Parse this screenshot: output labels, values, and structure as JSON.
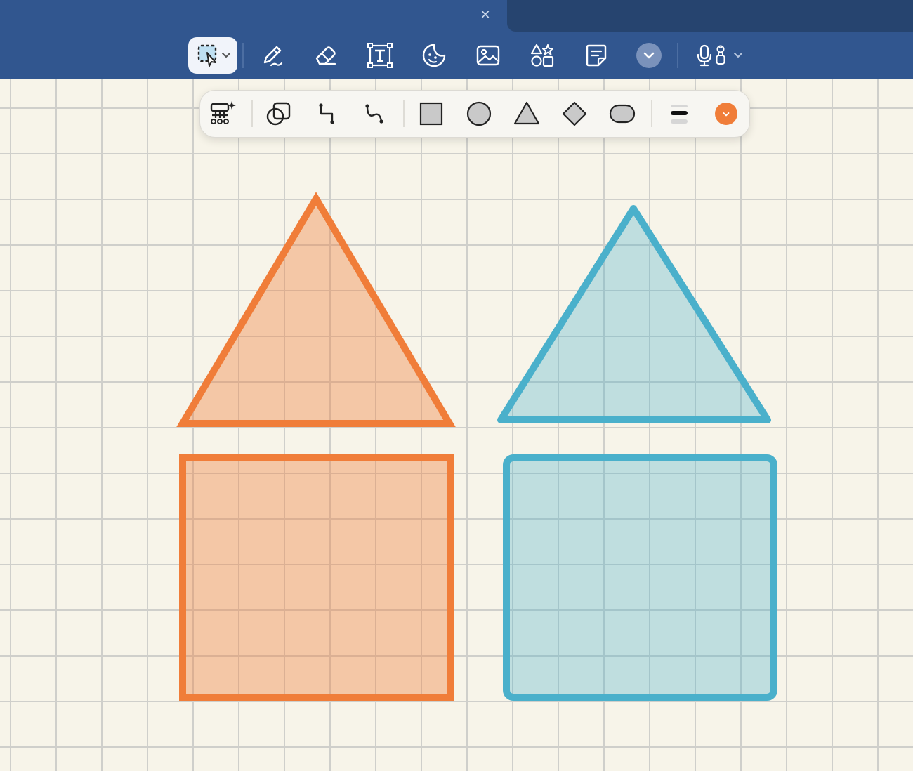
{
  "window": {
    "close_icon": "close-icon",
    "close_glyph": "✕"
  },
  "toolbar": {
    "tools": [
      {
        "id": "select",
        "icon": "lasso-select-icon",
        "selected": true
      },
      {
        "id": "pen",
        "icon": "pen-icon"
      },
      {
        "id": "eraser",
        "icon": "eraser-icon"
      },
      {
        "id": "text",
        "icon": "text-box-icon"
      },
      {
        "id": "sticker",
        "icon": "sticker-icon"
      },
      {
        "id": "image",
        "icon": "image-icon"
      },
      {
        "id": "shapes",
        "icon": "shapes-icon"
      },
      {
        "id": "note",
        "icon": "sticky-note-icon"
      },
      {
        "id": "more",
        "icon": "chevron-down-icon"
      },
      {
        "id": "voice",
        "icon": "microphone-icon"
      }
    ]
  },
  "shape_palette": {
    "items": [
      {
        "id": "smart-diagram",
        "icon": "smart-diagram-icon"
      },
      {
        "id": "shape-lib",
        "icon": "overlapping-shapes-icon"
      },
      {
        "id": "elbow-connector",
        "icon": "elbow-connector-icon"
      },
      {
        "id": "curved-connector",
        "icon": "curved-connector-icon"
      },
      {
        "id": "square",
        "icon": "square-icon"
      },
      {
        "id": "circle",
        "icon": "circle-icon"
      },
      {
        "id": "triangle",
        "icon": "triangle-icon"
      },
      {
        "id": "diamond",
        "icon": "diamond-icon"
      },
      {
        "id": "rounded-rect",
        "icon": "rounded-rectangle-icon"
      },
      {
        "id": "stroke",
        "icon": "stroke-weight-icon"
      },
      {
        "id": "color",
        "icon": "color-swatch-icon"
      }
    ],
    "selected_color": "#f07d39"
  },
  "canvas": {
    "shapes": [
      {
        "type": "triangle",
        "corners": "sharp",
        "stroke": "#f07d39",
        "fill": "rgba(240,125,57,0.38)"
      },
      {
        "type": "triangle",
        "corners": "rounded",
        "stroke": "#4ab0cb",
        "fill": "rgba(74,176,203,0.32)"
      },
      {
        "type": "rectangle",
        "corners": "sharp",
        "stroke": "#f07d39",
        "fill": "rgba(240,125,57,0.38)"
      },
      {
        "type": "rectangle",
        "corners": "rounded",
        "stroke": "#4ab0cb",
        "fill": "rgba(74,176,203,0.32)"
      }
    ]
  },
  "colors": {
    "toolbar_bg": "#31568f",
    "tab_bg": "#26446f",
    "canvas_bg": "#f7f4e9",
    "grid": "#cfcfcb",
    "orange": "#f07d39",
    "blue": "#4ab0cb"
  }
}
